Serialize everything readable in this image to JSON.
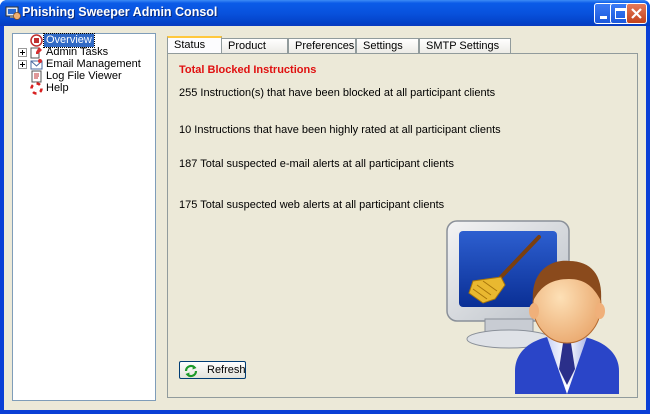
{
  "window": {
    "title": "Phishing Sweeper Admin Consol",
    "icon": "phishing-sweeper-app-icon"
  },
  "tree": {
    "items": [
      {
        "label": "Overview",
        "icon": "overview-icon",
        "expandable": false,
        "selected": true
      },
      {
        "label": "Admin Tasks",
        "icon": "admin-tasks-icon",
        "expandable": true,
        "selected": false
      },
      {
        "label": "Email Management",
        "icon": "email-management-icon",
        "expandable": true,
        "selected": false
      },
      {
        "label": "Log File Viewer",
        "icon": "log-file-icon",
        "expandable": false,
        "selected": false
      },
      {
        "label": "Help",
        "icon": "help-lifebuoy-icon",
        "expandable": false,
        "selected": false
      }
    ]
  },
  "tabs": [
    {
      "label": "Status",
      "active": true
    },
    {
      "label": "Product Info",
      "active": false
    },
    {
      "label": "Preferences",
      "active": false
    },
    {
      "label": "Settings",
      "active": false
    },
    {
      "label": "SMTP Settings",
      "active": false
    }
  ],
  "status": {
    "heading": "Total Blocked Instructions",
    "lines": [
      "255 Instruction(s) that have been blocked at all participant clients",
      "10 Instructions that have been highly rated at all participant clients",
      "187 Total suspected e-mail alerts at all participant clients",
      "175 Total suspected web alerts at all participant clients"
    ],
    "refresh_label": "Refresh"
  },
  "colors": {
    "heading": "#E01010",
    "titlebar": "#0852DD",
    "selection": "#316AC5"
  }
}
